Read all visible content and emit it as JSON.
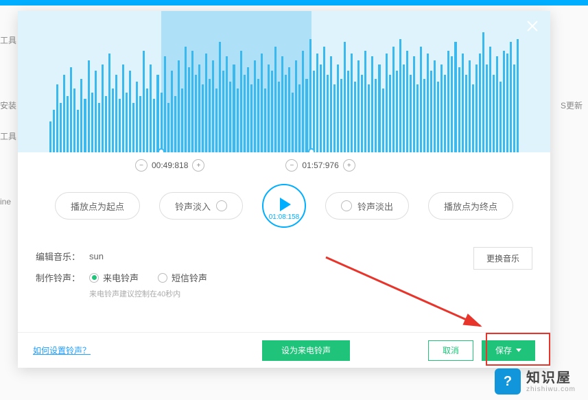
{
  "backdrop": {
    "truncated_left_1": "工具",
    "truncated_left_2": "工具",
    "truncated_install": "安装",
    "truncated_right": "S更新",
    "truncated_ine": "ine"
  },
  "dialog": {
    "time_start": "00:49:818",
    "time_end": "01:57:976",
    "controls": {
      "start_point": "播放点为起点",
      "fade_in": "铃声淡入",
      "fade_out": "铃声淡出",
      "end_point": "播放点为终点",
      "play_duration": "01:08:158"
    },
    "info": {
      "edit_music_label": "编辑音乐：",
      "edit_music_value": "sun",
      "make_ringtone_label": "制作铃声：",
      "opt_call": "来电铃声",
      "opt_sms": "短信铃声",
      "hint": "来电铃声建议控制在40秒内",
      "swap_music": "更换音乐"
    },
    "footer": {
      "help": "如何设置铃声？",
      "set_ringtone": "设为来电铃声",
      "cancel": "取消",
      "save": "保存"
    }
  },
  "logo": {
    "main": "知识屋",
    "sub": "zhishiwu.com"
  },
  "chart_data": {
    "type": "bar",
    "description": "Audio waveform amplitude bars",
    "selection_range_pct": [
      27,
      55
    ],
    "bars_pct": [
      22,
      30,
      48,
      35,
      55,
      40,
      60,
      45,
      30,
      52,
      38,
      65,
      42,
      58,
      35,
      62,
      40,
      70,
      45,
      55,
      38,
      62,
      42,
      58,
      35,
      50,
      40,
      72,
      45,
      62,
      38,
      55,
      42,
      68,
      35,
      58,
      40,
      65,
      45,
      75,
      60,
      72,
      55,
      62,
      48,
      70,
      52,
      65,
      45,
      78,
      58,
      68,
      50,
      62,
      45,
      72,
      55,
      60,
      48,
      65,
      52,
      70,
      45,
      62,
      58,
      75,
      50,
      68,
      55,
      60,
      42,
      65,
      48,
      72,
      52,
      80,
      58,
      70,
      62,
      75,
      55,
      68,
      48,
      62,
      52,
      78,
      58,
      70,
      50,
      65,
      55,
      72,
      48,
      68,
      52,
      62,
      45,
      70,
      55,
      75,
      58,
      80,
      62,
      72,
      55,
      68,
      48,
      75,
      52,
      70,
      58,
      65,
      50,
      62,
      55,
      72,
      68,
      78,
      60,
      70,
      55,
      65,
      48,
      62,
      70,
      85,
      62,
      75,
      55,
      68,
      50,
      72,
      70,
      78,
      62,
      80
    ]
  }
}
